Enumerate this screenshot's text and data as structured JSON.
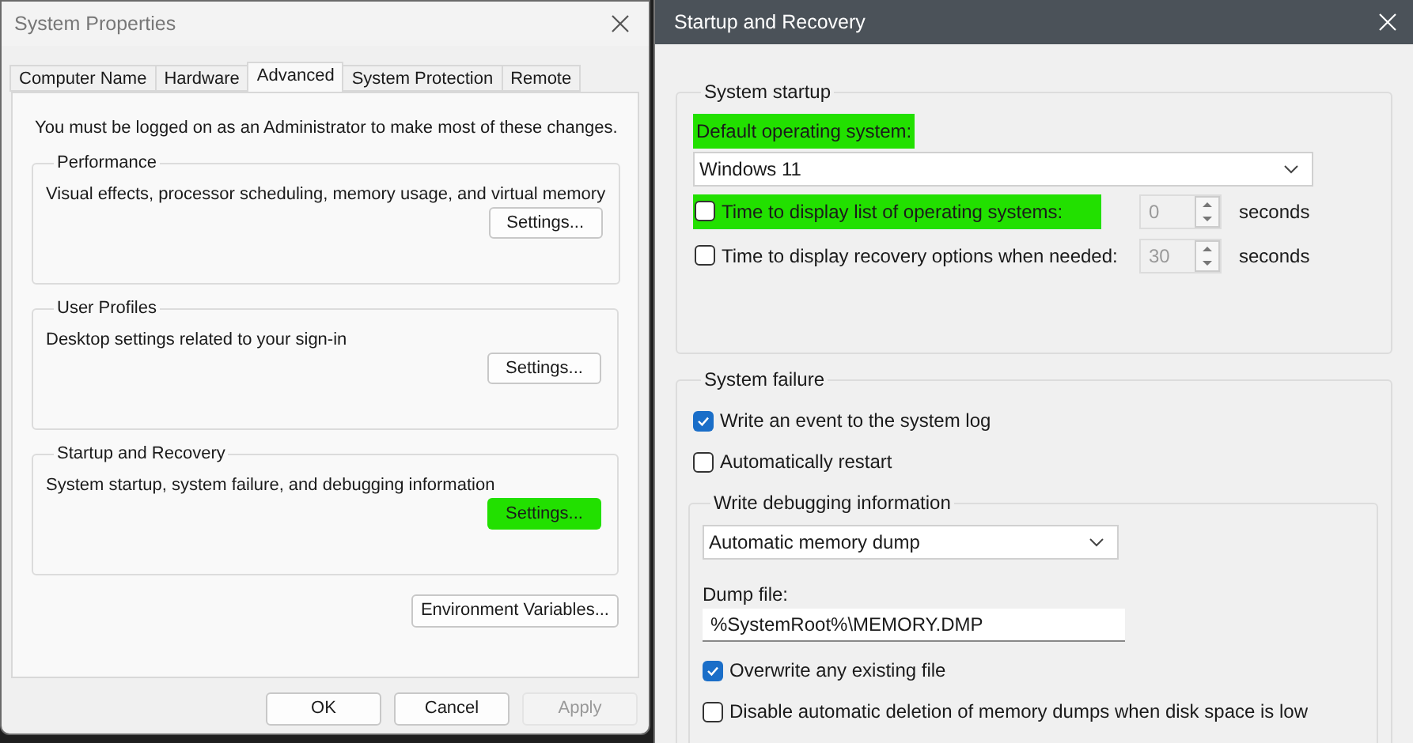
{
  "system_properties": {
    "title": "System Properties",
    "tabs": [
      {
        "label": "Computer Name",
        "selected": false
      },
      {
        "label": "Hardware",
        "selected": false
      },
      {
        "label": "Advanced",
        "selected": true
      },
      {
        "label": "System Protection",
        "selected": false
      },
      {
        "label": "Remote",
        "selected": false
      }
    ],
    "notice": "You must be logged on as an Administrator to make most of these changes.",
    "groups": [
      {
        "title": "Performance",
        "description": "Visual effects, processor scheduling, memory usage, and virtual memory",
        "button": {
          "label": "Settings...",
          "highlighted": false
        }
      },
      {
        "title": "User Profiles",
        "description": "Desktop settings related to your sign-in",
        "button": {
          "label": "Settings...",
          "highlighted": false
        }
      },
      {
        "title": "Startup and Recovery",
        "description": "System startup, system failure, and debugging information",
        "button": {
          "label": "Settings...",
          "highlighted": true
        }
      }
    ],
    "env_button": "Environment Variables...",
    "footer_buttons": [
      {
        "label": "OK",
        "disabled": false
      },
      {
        "label": "Cancel",
        "disabled": false
      },
      {
        "label": "Apply",
        "disabled": true
      }
    ]
  },
  "startup_recovery": {
    "title": "Startup and Recovery",
    "system_startup": {
      "title": "System startup",
      "default_os_label": {
        "text": "Default operating system:",
        "highlighted": true
      },
      "default_os": "Windows 11",
      "timers": [
        {
          "label": "Time to display list of operating systems:",
          "checked": false,
          "highlighted": true,
          "value": "0",
          "unit": "seconds"
        },
        {
          "label": "Time to display recovery options when needed:",
          "checked": false,
          "highlighted": false,
          "value": "30",
          "unit": "seconds"
        }
      ]
    },
    "system_failure": {
      "title": "System failure",
      "options": [
        {
          "label": "Write an event to the system log",
          "checked": true
        },
        {
          "label": "Automatically restart",
          "checked": false
        }
      ],
      "debugging": {
        "title": "Write debugging information",
        "dump_type": "Automatic memory dump",
        "dump_file_label": "Dump file:",
        "dump_file": "%SystemRoot%\\MEMORY.DMP",
        "options": [
          {
            "label": "Overwrite any existing file",
            "checked": true
          },
          {
            "label": "Disable automatic deletion of memory dumps when disk space is low",
            "checked": false
          }
        ]
      }
    }
  }
}
